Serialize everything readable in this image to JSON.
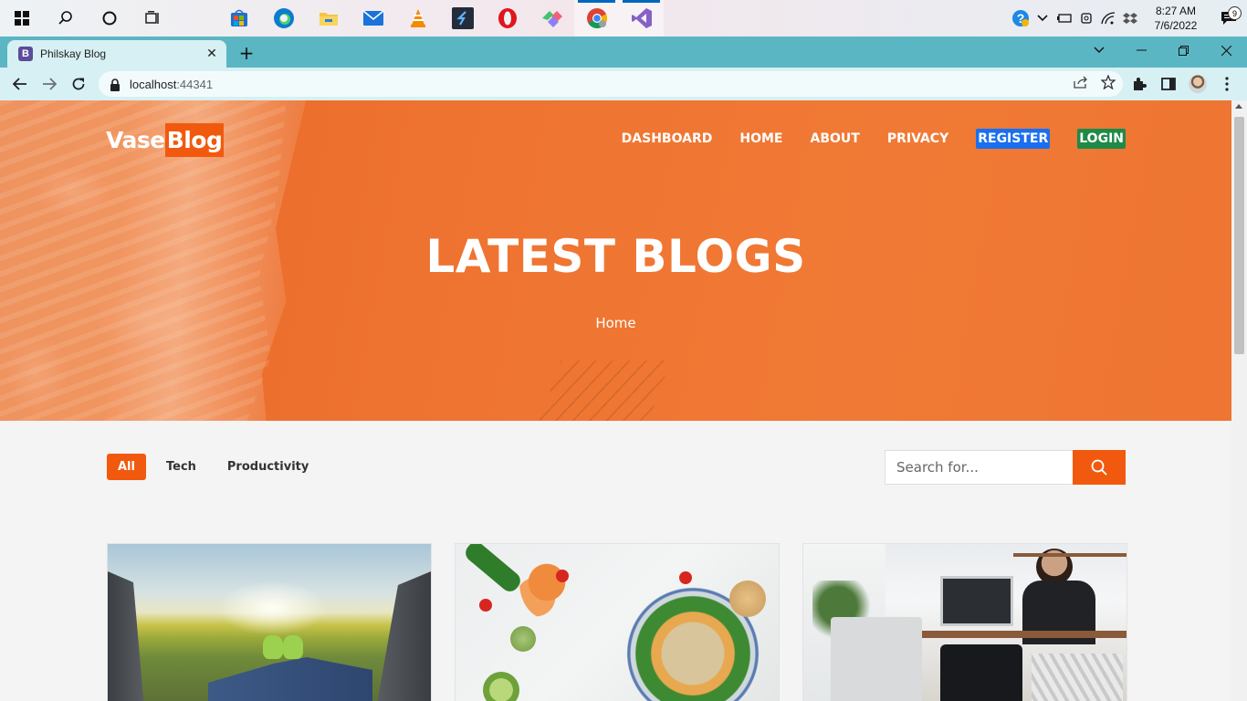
{
  "taskbar": {
    "clock_time": "8:27 AM",
    "clock_date": "7/6/2022",
    "notification_count": "9"
  },
  "browser": {
    "tab_title": "Philskay Blog",
    "tab_favicon": "B",
    "url_host": "localhost",
    "url_port": ":44341"
  },
  "site": {
    "brand_part1": "Vase",
    "brand_part2": "Blog",
    "nav": {
      "dashboard": "DASHBOARD",
      "home": "HOME",
      "about": "ABOUT",
      "privacy": "PRIVACY",
      "register": "REGISTER",
      "login": "LOGIN"
    },
    "hero_title": "LATEST BLOGS",
    "breadcrumb": "Home",
    "filters": {
      "all": "All",
      "tech": "Tech",
      "productivity": "Productivity"
    },
    "search_placeholder": "Search for..."
  },
  "colors": {
    "accent": "#f15a0e",
    "register_bg": "#1a6ff0",
    "login_bg": "#1f8a47",
    "tab_strip": "#5bb6c4"
  }
}
